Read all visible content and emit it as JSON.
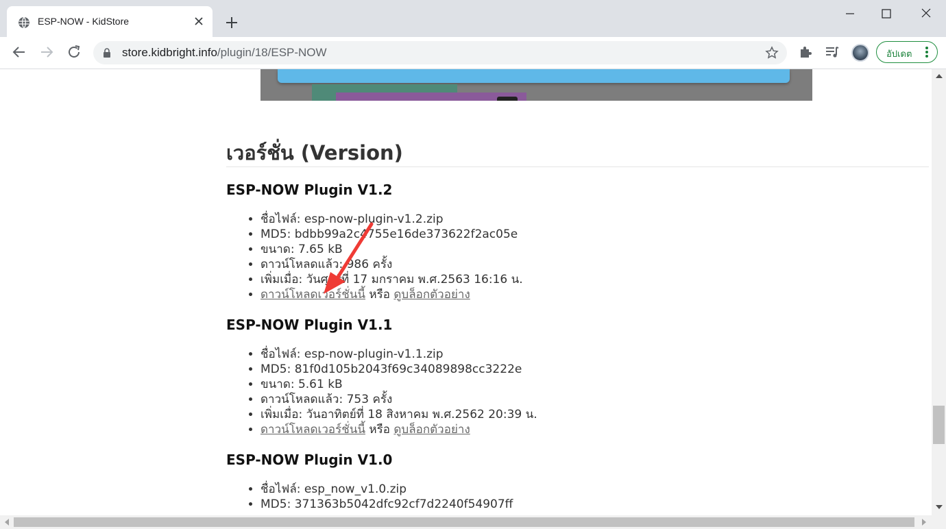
{
  "browser": {
    "tab_title": "ESP-NOW - KidStore",
    "url_host": "store.kidbright.info",
    "url_path": "/plugin/18/ESP-NOW",
    "update_label": "อัปเดต"
  },
  "page": {
    "section_title": "เวอร์ชั่น (Version)",
    "versions": [
      {
        "title": "ESP-NOW Plugin V1.2",
        "filename": "ชื่อไฟล์: esp-now-plugin-v1.2.zip",
        "md5": "MD5: bdbb99a2c47​55e16de373622f2ac05e",
        "size": "ขนาด: 7.65 kB",
        "downloads": "ดาวน์โหลดแล้ว: 986 ครั้ง",
        "added": "เพิ่มเมื่อ: วันศุกร์ที่ 17 มกราคม พ.ศ.2563 16:16 น.",
        "download_link": "ดาวน์โหลดเวอร์ชั่นนี้",
        "or": " หรือ ",
        "example_link": "ดูบล็อกตัวอย่าง"
      },
      {
        "title": "ESP-NOW Plugin V1.1",
        "filename": "ชื่อไฟล์: esp-now-plugin-v1.1.zip",
        "md5": "MD5: 81f0d105b2043f69c34089898cc3222e",
        "size": "ขนาด: 5.61 kB",
        "downloads": "ดาวน์โหลดแล้ว: 753 ครั้ง",
        "added": "เพิ่มเมื่อ: วันอาทิตย์ที่ 18 สิงหาคม พ.ศ.2562 20:39 น.",
        "download_link": "ดาวน์โหลดเวอร์ชั่นนี้",
        "or": " หรือ ",
        "example_link": "ดูบล็อกตัวอย่าง"
      },
      {
        "title": "ESP-NOW Plugin V1.0",
        "filename": "ชื่อไฟล์: esp_now_v1.0.zip",
        "md5": "MD5: 371363b5042dfc92cf7d2240f54907ff"
      }
    ]
  },
  "colors": {
    "accent_green": "#188038",
    "annotation_arrow": "#ef3b35",
    "link": "#666666"
  },
  "icons": [
    "globe-icon",
    "close-icon",
    "plus-icon",
    "minimize-icon",
    "maximize-icon",
    "window-close-icon",
    "back-arrow-icon",
    "forward-arrow-icon",
    "reload-icon",
    "lock-icon",
    "star-icon",
    "puzzle-icon",
    "media-queue-icon",
    "more-vert-icon"
  ]
}
